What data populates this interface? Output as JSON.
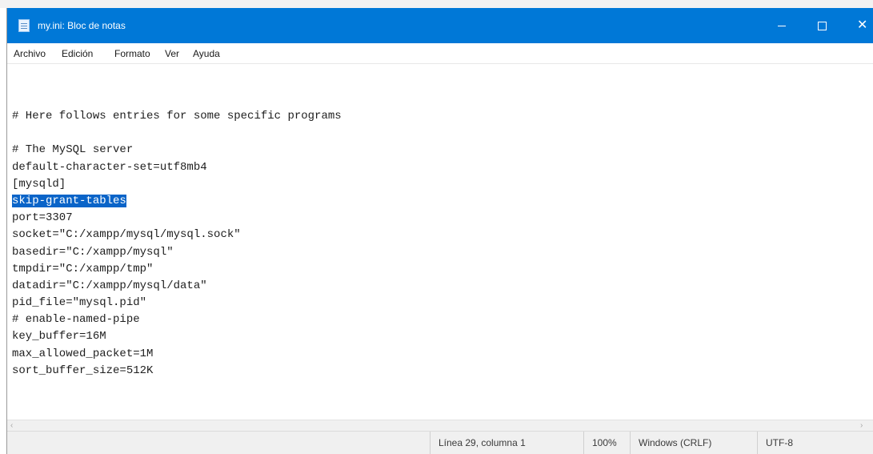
{
  "window": {
    "title": "my.ini: Bloc de notas",
    "minimize_glyph": "—",
    "maximize_glyph": "□",
    "close_glyph": "✕"
  },
  "menu": [
    "Archivo",
    "Edición",
    "Formato",
    "Ver",
    "Ayuda"
  ],
  "editor": {
    "lines": [
      "# Here follows entries for some specific programs",
      "",
      "# The MySQL server",
      "default-character-set=utf8mb4",
      "[mysqld]",
      "skip-grant-tables",
      "port=3307",
      "socket=\"C:/xampp/mysql/mysql.sock\"",
      "basedir=\"C:/xampp/mysql\"",
      "tmpdir=\"C:/xampp/tmp\"",
      "datadir=\"C:/xampp/mysql/data\"",
      "pid_file=\"mysql.pid\"",
      "# enable-named-pipe",
      "key_buffer=16M",
      "max_allowed_packet=1M",
      "sort_buffer_size=512K"
    ],
    "selected_line_index": 5,
    "selection_color": "#0a64c8"
  },
  "scrollbar": {
    "left_arrow": "‹",
    "right_arrow": "›"
  },
  "status": {
    "position": "Línea 29, columna 1",
    "zoom": "100%",
    "line_ending": "Windows (CRLF)",
    "encoding": "UTF-8"
  },
  "colors": {
    "titlebar": "#0078d7",
    "statusbar": "#f0f0f0"
  }
}
